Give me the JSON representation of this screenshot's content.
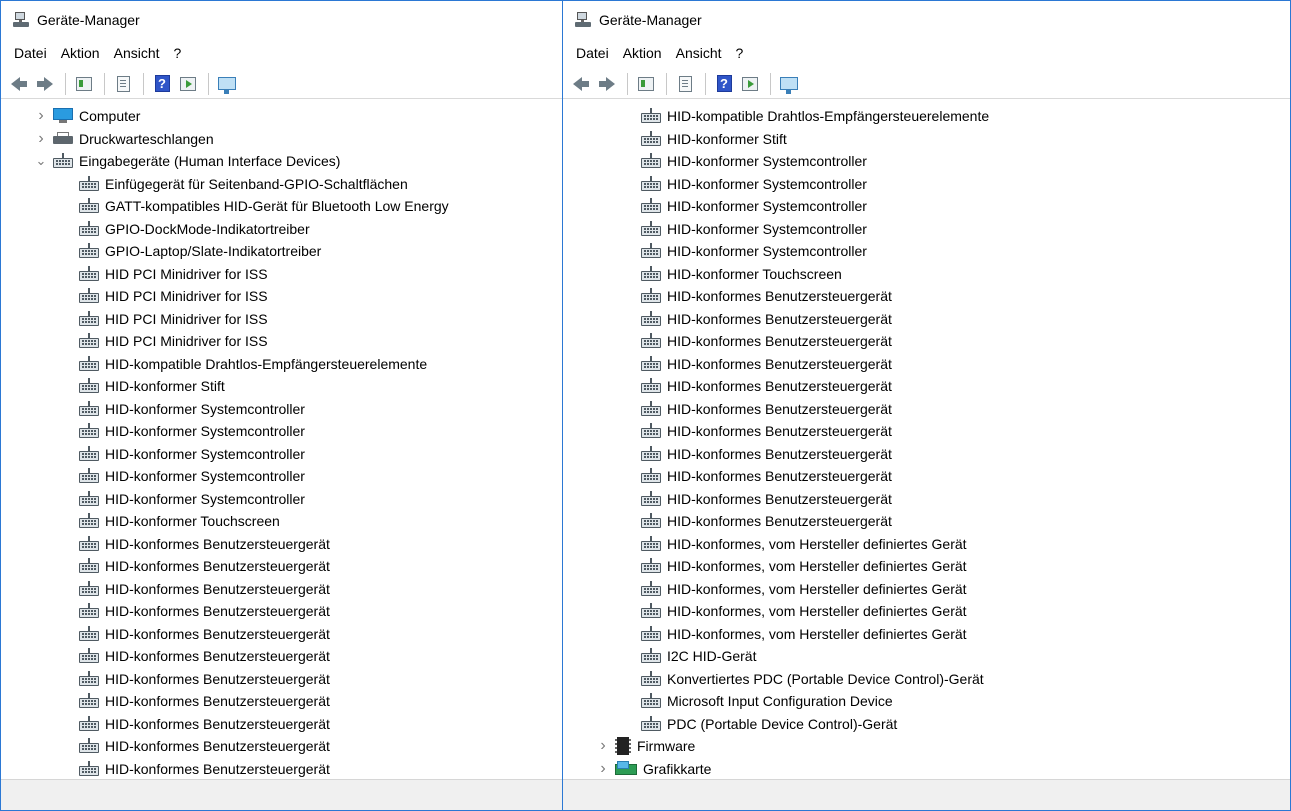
{
  "left": {
    "title": "Geräte-Manager",
    "menu": [
      {
        "label": "Datei"
      },
      {
        "label": "Aktion"
      },
      {
        "label": "Ansicht"
      },
      {
        "label": "?"
      }
    ],
    "tree": [
      {
        "label": "Computer",
        "level": 0,
        "expander": "collapsed",
        "icon": "computer-icon"
      },
      {
        "label": "Druckwarteschlangen",
        "level": 0,
        "expander": "collapsed",
        "icon": "printer-icon"
      },
      {
        "label": "Eingabegeräte (Human Interface Devices)",
        "level": 0,
        "expander": "expanded",
        "icon": "hid-icon"
      },
      {
        "label": "Einfügegerät für Seitenband-GPIO-Schaltflächen",
        "level": 1,
        "icon": "hid-icon"
      },
      {
        "label": "GATT-kompatibles HID-Gerät für Bluetooth Low Energy",
        "level": 1,
        "icon": "hid-icon"
      },
      {
        "label": "GPIO-DockMode-Indikatortreiber",
        "level": 1,
        "icon": "hid-icon"
      },
      {
        "label": "GPIO-Laptop/Slate-Indikatortreiber",
        "level": 1,
        "icon": "hid-icon"
      },
      {
        "label": "HID PCI Minidriver for ISS",
        "level": 1,
        "icon": "hid-icon"
      },
      {
        "label": "HID PCI Minidriver for ISS",
        "level": 1,
        "icon": "hid-icon"
      },
      {
        "label": "HID PCI Minidriver for ISS",
        "level": 1,
        "icon": "hid-icon"
      },
      {
        "label": "HID PCI Minidriver for ISS",
        "level": 1,
        "icon": "hid-icon"
      },
      {
        "label": "HID-kompatible Drahtlos-Empfängersteuerelemente",
        "level": 1,
        "icon": "hid-icon"
      },
      {
        "label": "HID-konformer Stift",
        "level": 1,
        "icon": "hid-icon"
      },
      {
        "label": "HID-konformer Systemcontroller",
        "level": 1,
        "icon": "hid-icon"
      },
      {
        "label": "HID-konformer Systemcontroller",
        "level": 1,
        "icon": "hid-icon"
      },
      {
        "label": "HID-konformer Systemcontroller",
        "level": 1,
        "icon": "hid-icon"
      },
      {
        "label": "HID-konformer Systemcontroller",
        "level": 1,
        "icon": "hid-icon"
      },
      {
        "label": "HID-konformer Systemcontroller",
        "level": 1,
        "icon": "hid-icon"
      },
      {
        "label": "HID-konformer Touchscreen",
        "level": 1,
        "icon": "hid-icon"
      },
      {
        "label": "HID-konformes Benutzersteuergerät",
        "level": 1,
        "icon": "hid-icon"
      },
      {
        "label": "HID-konformes Benutzersteuergerät",
        "level": 1,
        "icon": "hid-icon"
      },
      {
        "label": "HID-konformes Benutzersteuergerät",
        "level": 1,
        "icon": "hid-icon"
      },
      {
        "label": "HID-konformes Benutzersteuergerät",
        "level": 1,
        "icon": "hid-icon"
      },
      {
        "label": "HID-konformes Benutzersteuergerät",
        "level": 1,
        "icon": "hid-icon"
      },
      {
        "label": "HID-konformes Benutzersteuergerät",
        "level": 1,
        "icon": "hid-icon"
      },
      {
        "label": "HID-konformes Benutzersteuergerät",
        "level": 1,
        "icon": "hid-icon"
      },
      {
        "label": "HID-konformes Benutzersteuergerät",
        "level": 1,
        "icon": "hid-icon"
      },
      {
        "label": "HID-konformes Benutzersteuergerät",
        "level": 1,
        "icon": "hid-icon"
      },
      {
        "label": "HID-konformes Benutzersteuergerät",
        "level": 1,
        "icon": "hid-icon"
      },
      {
        "label": "HID-konformes Benutzersteuergerät",
        "level": 1,
        "icon": "hid-icon"
      }
    ]
  },
  "right": {
    "title": "Geräte-Manager",
    "menu": [
      {
        "label": "Datei"
      },
      {
        "label": "Aktion"
      },
      {
        "label": "Ansicht"
      },
      {
        "label": "?"
      }
    ],
    "tree": [
      {
        "label": "HID-kompatible Drahtlos-Empfängersteuerelemente",
        "level": 1,
        "icon": "hid-icon"
      },
      {
        "label": "HID-konformer Stift",
        "level": 1,
        "icon": "hid-icon"
      },
      {
        "label": "HID-konformer Systemcontroller",
        "level": 1,
        "icon": "hid-icon"
      },
      {
        "label": "HID-konformer Systemcontroller",
        "level": 1,
        "icon": "hid-icon"
      },
      {
        "label": "HID-konformer Systemcontroller",
        "level": 1,
        "icon": "hid-icon"
      },
      {
        "label": "HID-konformer Systemcontroller",
        "level": 1,
        "icon": "hid-icon"
      },
      {
        "label": "HID-konformer Systemcontroller",
        "level": 1,
        "icon": "hid-icon"
      },
      {
        "label": "HID-konformer Touchscreen",
        "level": 1,
        "icon": "hid-icon"
      },
      {
        "label": "HID-konformes Benutzersteuergerät",
        "level": 1,
        "icon": "hid-icon"
      },
      {
        "label": "HID-konformes Benutzersteuergerät",
        "level": 1,
        "icon": "hid-icon"
      },
      {
        "label": "HID-konformes Benutzersteuergerät",
        "level": 1,
        "icon": "hid-icon"
      },
      {
        "label": "HID-konformes Benutzersteuergerät",
        "level": 1,
        "icon": "hid-icon"
      },
      {
        "label": "HID-konformes Benutzersteuergerät",
        "level": 1,
        "icon": "hid-icon"
      },
      {
        "label": "HID-konformes Benutzersteuergerät",
        "level": 1,
        "icon": "hid-icon"
      },
      {
        "label": "HID-konformes Benutzersteuergerät",
        "level": 1,
        "icon": "hid-icon"
      },
      {
        "label": "HID-konformes Benutzersteuergerät",
        "level": 1,
        "icon": "hid-icon"
      },
      {
        "label": "HID-konformes Benutzersteuergerät",
        "level": 1,
        "icon": "hid-icon"
      },
      {
        "label": "HID-konformes Benutzersteuergerät",
        "level": 1,
        "icon": "hid-icon"
      },
      {
        "label": "HID-konformes Benutzersteuergerät",
        "level": 1,
        "icon": "hid-icon"
      },
      {
        "label": "HID-konformes, vom Hersteller definiertes Gerät",
        "level": 1,
        "icon": "hid-icon"
      },
      {
        "label": "HID-konformes, vom Hersteller definiertes Gerät",
        "level": 1,
        "icon": "hid-icon"
      },
      {
        "label": "HID-konformes, vom Hersteller definiertes Gerät",
        "level": 1,
        "icon": "hid-icon"
      },
      {
        "label": "HID-konformes, vom Hersteller definiertes Gerät",
        "level": 1,
        "icon": "hid-icon"
      },
      {
        "label": "HID-konformes, vom Hersteller definiertes Gerät",
        "level": 1,
        "icon": "hid-icon"
      },
      {
        "label": "I2C HID-Gerät",
        "level": 1,
        "icon": "hid-icon"
      },
      {
        "label": "Konvertiertes PDC (Portable Device Control)-Gerät",
        "level": 1,
        "icon": "hid-icon"
      },
      {
        "label": "Microsoft Input Configuration Device",
        "level": 1,
        "icon": "hid-icon"
      },
      {
        "label": "PDC (Portable Device Control)-Gerät",
        "level": 1,
        "icon": "hid-icon"
      },
      {
        "label": "Firmware",
        "level": 0,
        "expander": "collapsed",
        "icon": "firmware-icon"
      },
      {
        "label": "Grafikkarte",
        "level": 0,
        "expander": "collapsed",
        "icon": "display-adapter-icon"
      }
    ]
  }
}
